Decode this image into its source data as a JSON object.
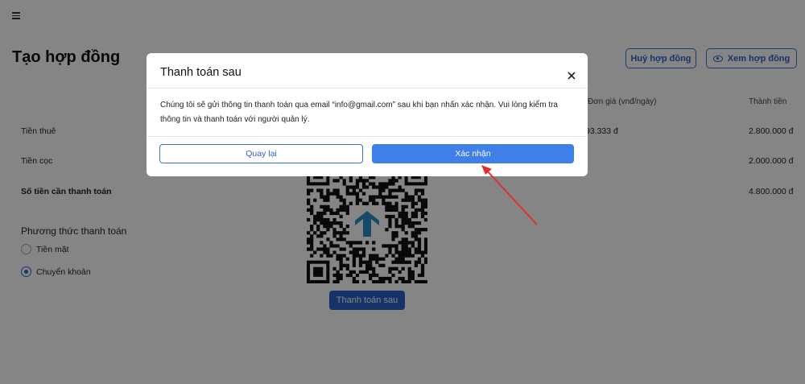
{
  "header": {
    "menu_icon": "hamburger-icon"
  },
  "page": {
    "title": "Tạo hợp đồng",
    "cancel_contract": "Huỷ hợp đồng",
    "view_contract": "Xem hợp đồng"
  },
  "table": {
    "headers": {
      "unit_price": "Đơn giá (vnđ/ngày)",
      "total": "Thành tiền"
    },
    "rows": [
      {
        "label": "Tiền thuê",
        "unit_price": "93.333 đ",
        "total": "2.800.000 đ"
      },
      {
        "label": "Tiền cọc",
        "total": "2.000.000 đ"
      },
      {
        "label": "Số tiền cần thanh toán",
        "total": "4.800.000 đ"
      }
    ]
  },
  "payment": {
    "title": "Phương thức thanh toán",
    "options": [
      {
        "label": "Tiền mặt",
        "selected": false
      },
      {
        "label": "Chuyển khoản",
        "selected": true
      }
    ],
    "pay_later_button": "Thanh toán sau"
  },
  "modal": {
    "title": "Thanh toán sau",
    "body": "Chúng tôi sẽ gửi thông tin thanh toán qua email “info@gmail.com” sau khi bạn nhấn xác nhận. Vui lòng kiểm tra thông tin và thanh toán với người quản lý.",
    "back_button": "Quay lại",
    "confirm_button": "Xác nhận"
  },
  "colors": {
    "primary": "#2f63c9",
    "confirm": "#3f7fe8",
    "annotation_arrow": "#e0302a"
  }
}
